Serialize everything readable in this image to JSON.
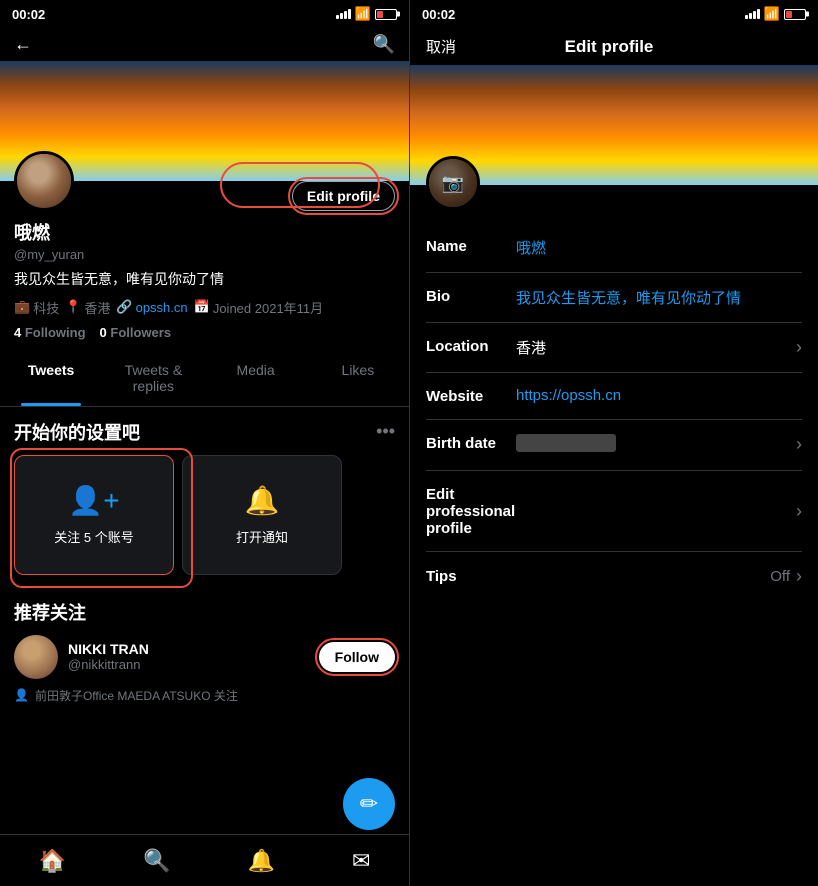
{
  "left": {
    "statusBar": {
      "time": "00:02",
      "locationIcon": "↑"
    },
    "tabs": [
      {
        "label": "Tweets",
        "active": true
      },
      {
        "label": "Tweets & replies",
        "active": false
      },
      {
        "label": "Media",
        "active": false
      },
      {
        "label": "Likes",
        "active": false
      }
    ],
    "profile": {
      "displayName": "哦燃",
      "username": "@my_yuran",
      "bio": "我见众生皆无意，唯有见你动了情",
      "meta": [
        {
          "icon": "💼",
          "text": "科技"
        },
        {
          "icon": "📍",
          "text": "香港"
        },
        {
          "icon": "🔗",
          "text": "opssh.cn"
        },
        {
          "icon": "📅",
          "text": "Joined 2021年11月"
        }
      ],
      "following": "4",
      "followingLabel": "Following",
      "followers": "0",
      "followersLabel": "Followers",
      "editProfileLabel": "Edit profile"
    },
    "setup": {
      "title": "开始你的设置吧",
      "cards": [
        {
          "icon": "👤+",
          "label": "关注 5 个账号"
        },
        {
          "icon": "🔔",
          "label": "打开通知"
        }
      ]
    },
    "recommend": {
      "title": "推荐关注",
      "items": [
        {
          "name": "NIKKI TRAN",
          "handle": "@nikkittrann",
          "followLabel": "Follow",
          "mutual": "前田敦子Office MAEDA ATSUKO 关注"
        }
      ]
    },
    "nav": [
      "🏠",
      "🔍",
      "🔔",
      "✉"
    ]
  },
  "right": {
    "statusBar": {
      "time": "00:02",
      "locationIcon": "↑"
    },
    "header": {
      "cancelLabel": "取消",
      "title": "Edit profile"
    },
    "fields": [
      {
        "label": "Name",
        "value": "哦燃",
        "type": "text"
      },
      {
        "label": "Bio",
        "value": "我见众生皆无意，唯有见你动了情",
        "type": "text"
      },
      {
        "label": "Location",
        "value": "香港",
        "type": "dropdown"
      },
      {
        "label": "Website",
        "value": "https://opssh.cn",
        "type": "link"
      },
      {
        "label": "Birth date",
        "value": "",
        "type": "blur-dropdown"
      },
      {
        "label": "Edit professional profile",
        "value": "",
        "type": "arrow"
      },
      {
        "label": "Tips",
        "value": "Off",
        "type": "tips"
      }
    ]
  }
}
